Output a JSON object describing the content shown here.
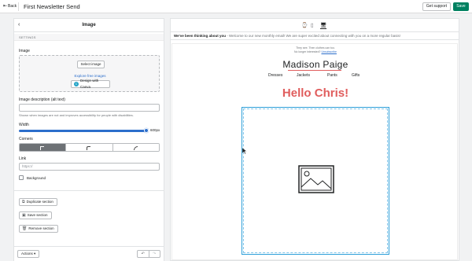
{
  "topbar": {
    "back_label": "Back",
    "title": "First Newsletter Send",
    "support_label": "Get support",
    "save_label": "Save"
  },
  "panel": {
    "title": "Image",
    "section_header": "SETTINGS",
    "image_label": "Image",
    "select_image_label": "Select image",
    "explore_link": "Explore free images",
    "canva_label": "Design with Canva",
    "alt_label": "Image description (alt text)",
    "alt_value": "",
    "alt_help": "Shown when images are not and improves accessibility for people with disabilities.",
    "width_label": "Width",
    "width_value": "600px",
    "width_fraction": 1.0,
    "corners_label": "Corners",
    "corners_selected": "square",
    "link_label": "Link",
    "link_placeholder": "https://",
    "background_label": "Background",
    "duplicate_label": "Duplicate section",
    "save_section_label": "Save section",
    "remove_section_label": "Remove section",
    "actions_label": "Actions"
  },
  "preview": {
    "preheader_bold": "We've been thinking about you",
    "preheader_text": " - Welcome to our new monthly email! We are super excited about connecting with you on a more regular basis!",
    "tiny_line1": "They see. Then clothes can too.",
    "tiny_line2_text": "No longer interested? ",
    "tiny_line2_link": "Unsubscribe",
    "brand": "Madison Paige",
    "nav": [
      "Dresses",
      "Jackets",
      "Pants",
      "Gifts"
    ],
    "headline": "Hello Chris!"
  },
  "icons": [
    "back-arrow-icon",
    "watch-icon",
    "mobile-icon",
    "desktop-icon",
    "canva-icon",
    "duplicate-icon",
    "save-icon",
    "trash-icon",
    "chevron-down-icon",
    "undo-icon",
    "redo-icon",
    "image-placeholder-icon",
    "mouse-cursor-icon"
  ],
  "colors": {
    "save_green": "#008060",
    "link_blue": "#2c6ecb",
    "headline_red": "#e05d5d"
  }
}
